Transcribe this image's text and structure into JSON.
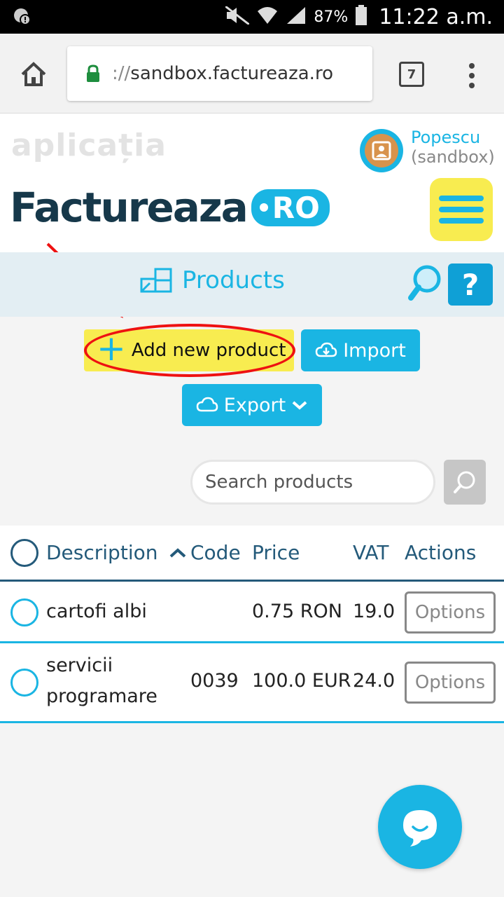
{
  "status_bar": {
    "battery": "87%",
    "time": "11:22 a.m."
  },
  "browser": {
    "url_scheme": "://",
    "url_host": "sandbox.factureaza.ro",
    "tab_count": "7"
  },
  "header": {
    "aplicatia": "aplicația",
    "brand_name": "Factureaza",
    "brand_suffix": "RO",
    "user_name": "Popescu",
    "user_env": "(sandbox)"
  },
  "page": {
    "title": "Products",
    "help_label": "?"
  },
  "actions": {
    "add_label": "Add new product",
    "import_label": "Import",
    "export_label": "Export"
  },
  "search": {
    "placeholder": "Search products"
  },
  "table": {
    "columns": {
      "description": "Description",
      "code": "Code",
      "price": "Price",
      "vat": "VAT",
      "actions": "Actions"
    },
    "rows": [
      {
        "description_1": "cartofi albi",
        "description_2": "",
        "code": "",
        "price": "0.75 RON",
        "vat": "19.0",
        "action": "Options"
      },
      {
        "description_1": "servicii",
        "description_2": "programare",
        "code": "0039",
        "price": "100.0 EUR",
        "vat": "24.0",
        "action": "Options"
      }
    ]
  },
  "colors": {
    "accent": "#1ab5e3",
    "highlight": "#f8ec50",
    "brand_dark": "#16384a",
    "annotation": "#e11111"
  }
}
